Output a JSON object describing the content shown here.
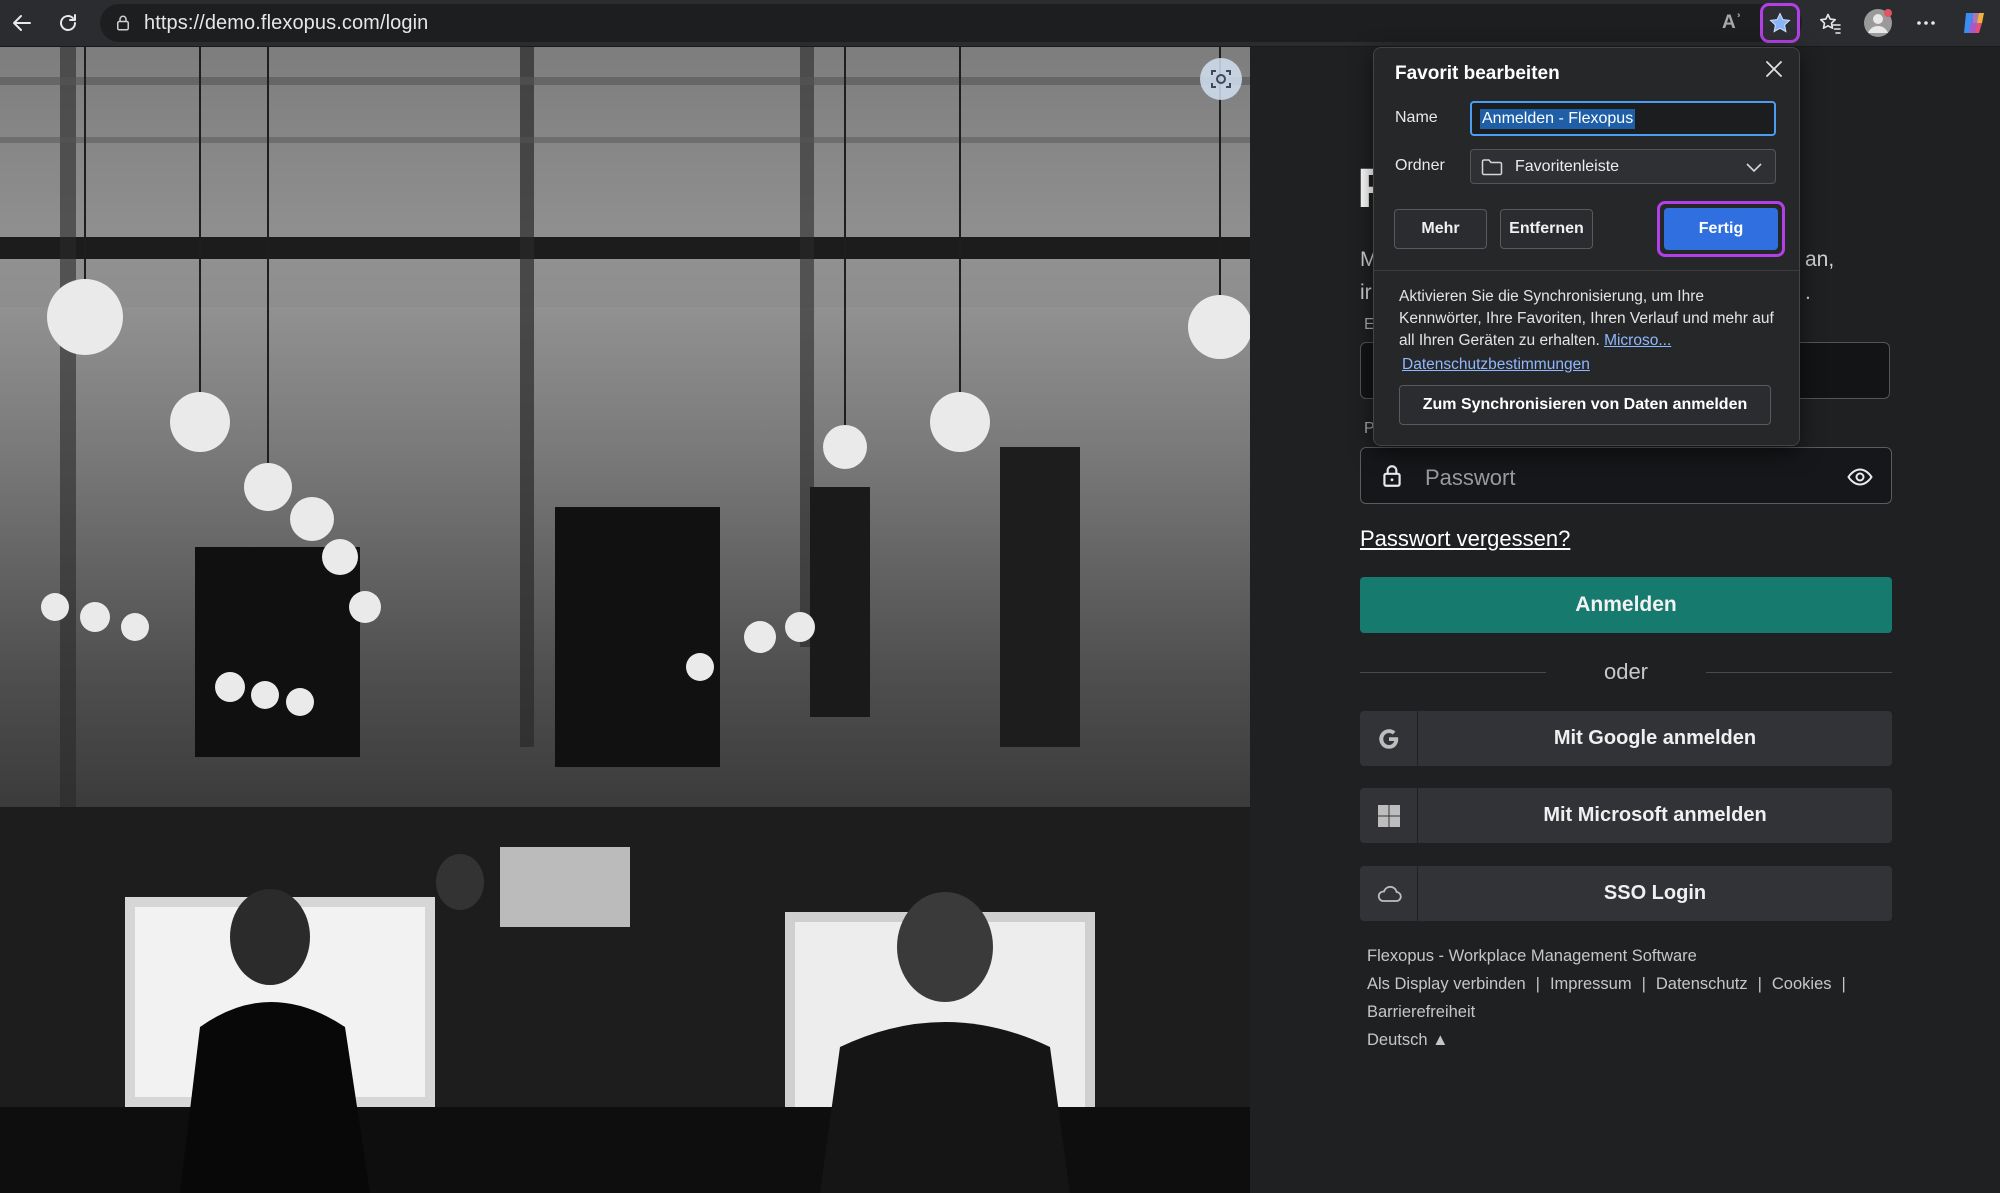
{
  "browser": {
    "url": "https://demo.flexopus.com/login",
    "read_aloud": "Aʾ"
  },
  "login": {
    "heading_letter": "F",
    "intro_left": [
      "M",
      "ir"
    ],
    "intro_right": [
      "an,",
      "."
    ],
    "email_label": "E",
    "password_label": "P",
    "password_placeholder": "Passwort",
    "forgot_link": "Passwort vergessen?",
    "login_button": "Anmelden",
    "divider_text": "oder",
    "google_button": "Mit Google anmelden",
    "microsoft_button": "Mit Microsoft anmelden",
    "sso_button": "SSO Login"
  },
  "footer": {
    "product": "Flexopus - Workplace Management Software",
    "links": [
      "Als Display verbinden",
      "Impressum",
      "Datenschutz",
      "Cookies"
    ],
    "link_accessibility": "Barrierefreiheit",
    "language": "Deutsch ▲"
  },
  "favorite_popup": {
    "title": "Favorit bearbeiten",
    "name_label": "Name",
    "name_value": "Anmelden - Flexopus",
    "folder_label": "Ordner",
    "folder_value": "Favoritenleiste",
    "more_button": "Mehr",
    "remove_button": "Entfernen",
    "done_button": "Fertig",
    "sync_text": "Aktivieren Sie die Synchronisierung, um Ihre Kennwörter, Ihre Favoriten, Ihren Verlauf und mehr auf all Ihren Geräten zu erhalten.",
    "sync_link": "Microso...",
    "privacy_link": "Datenschutzbestimmungen",
    "signin_button": "Zum Synchronisieren von Daten anmelden"
  },
  "colors": {
    "accent_teal": "#167a6e",
    "highlight_purple": "#b340e6",
    "primary_blue": "#2f6fe0"
  }
}
